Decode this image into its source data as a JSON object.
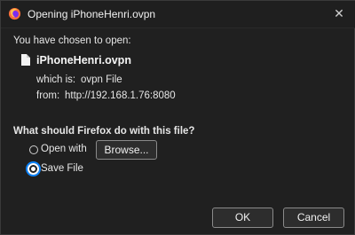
{
  "window": {
    "title": "Opening iPhoneHenri.ovpn",
    "app_icon": "firefox-icon",
    "close_glyph": "✕"
  },
  "intro": "You have chosen to open:",
  "file": {
    "name": "iPhoneHenri.ovpn",
    "type_label": "which is:",
    "type_value": "ovpn File",
    "from_label": "from:",
    "from_value": "http://192.168.1.76:8080"
  },
  "question": "What should Firefox do with this file?",
  "options": {
    "open_with": {
      "label": "Open with",
      "selected": false
    },
    "browse_label": "Browse...",
    "save_file": {
      "label": "Save File",
      "selected": true
    }
  },
  "buttons": {
    "ok": "OK",
    "cancel": "Cancel"
  },
  "colors": {
    "accent": "#0a84ff",
    "background": "#202020"
  }
}
